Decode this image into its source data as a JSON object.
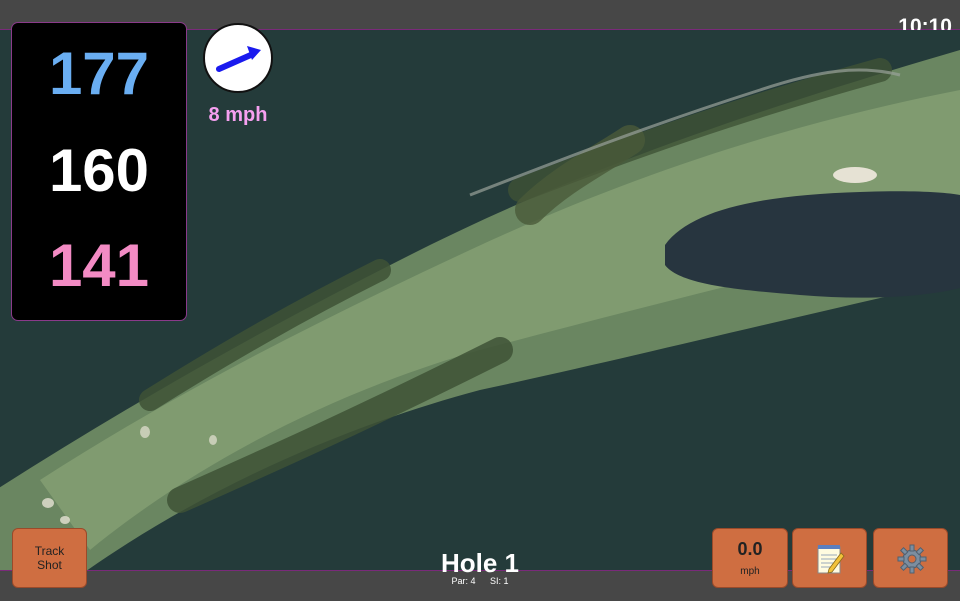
{
  "status": {
    "time": "10:10"
  },
  "distances": {
    "back": "177",
    "middle": "160",
    "front": "141"
  },
  "wind": {
    "speed_text": "8 mph"
  },
  "buttons": {
    "track_shot_line1": "Track",
    "track_shot_line2": "Shot",
    "speed_value": "0.0",
    "speed_unit": "mph"
  },
  "hole": {
    "title": "Hole 1",
    "par": "Par: 4",
    "si": "SI: 1"
  },
  "icons": {
    "wind_arrow": "arrow-icon",
    "notes": "notepad-icon",
    "settings": "gear-icon"
  },
  "colors": {
    "back_distance": "#6aaef2",
    "middle_distance": "#ffffff",
    "front_distance": "#f38bc4",
    "wind_speed": "#f6a0f0",
    "button": "#cf6e41"
  }
}
